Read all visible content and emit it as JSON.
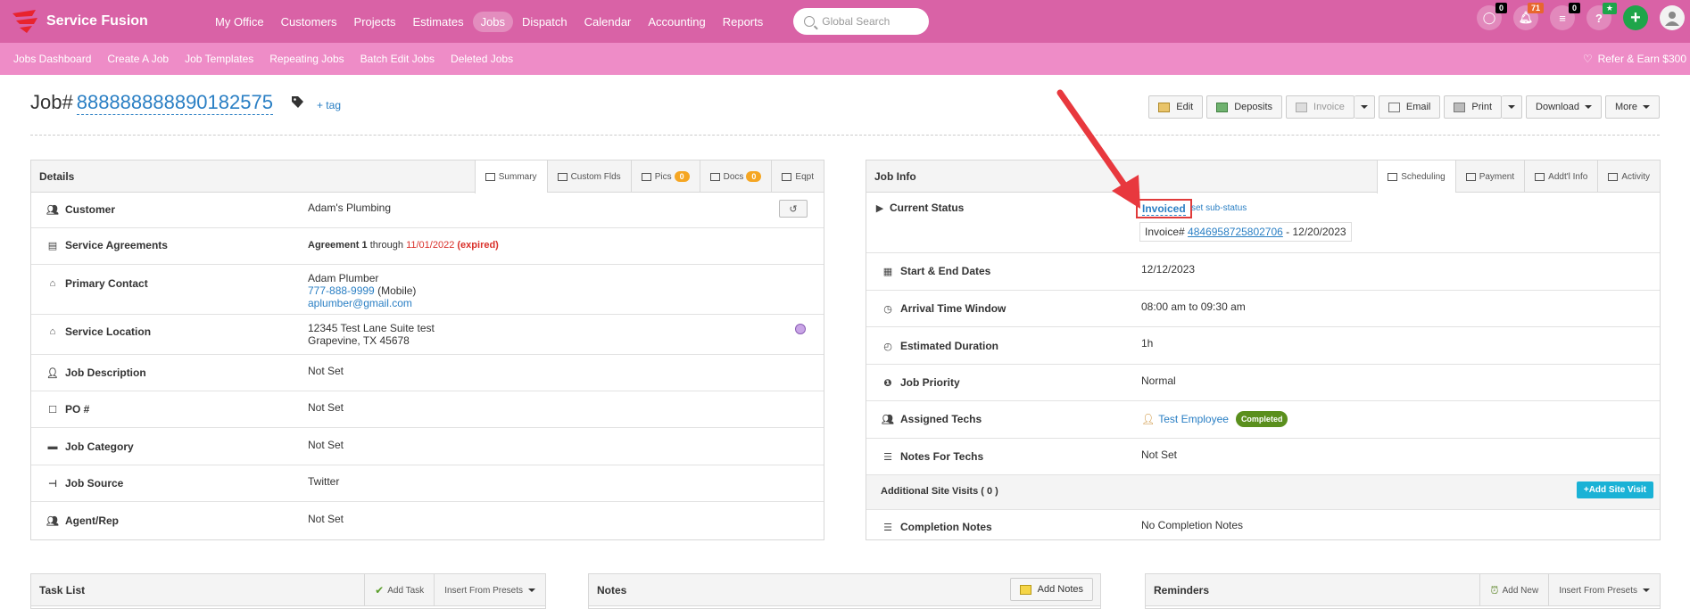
{
  "app": {
    "name": "Service Fusion"
  },
  "topnav": {
    "items": [
      {
        "label": "My Office",
        "active": false
      },
      {
        "label": "Customers",
        "active": false
      },
      {
        "label": "Projects",
        "active": false
      },
      {
        "label": "Estimates",
        "active": false
      },
      {
        "label": "Jobs",
        "active": true
      },
      {
        "label": "Dispatch",
        "active": false
      },
      {
        "label": "Calendar",
        "active": false
      },
      {
        "label": "Accounting",
        "active": false
      },
      {
        "label": "Reports",
        "active": false
      }
    ],
    "search_placeholder": "Global Search",
    "chat_count": "0",
    "notif_count": "71",
    "tasks_count": "0",
    "help": "?",
    "plus": "+",
    "brand_color": "#d962a6"
  },
  "subnav": {
    "items": [
      "Jobs Dashboard",
      "Create A Job",
      "Job Templates",
      "Repeating Jobs",
      "Batch Edit Jobs",
      "Deleted Jobs"
    ],
    "refer": "Refer & Earn $300"
  },
  "job": {
    "label": "Job#",
    "number": "888888888890182575",
    "add_tag": "+ tag"
  },
  "actions": {
    "edit": "Edit",
    "deposits": "Deposits",
    "invoice": "Invoice",
    "email": "Email",
    "print": "Print",
    "download": "Download",
    "more": "More"
  },
  "details": {
    "title": "Details",
    "tabs": [
      {
        "label": "Summary",
        "active": true
      },
      {
        "label": "Custom Flds"
      },
      {
        "label": "Pics",
        "count": "0"
      },
      {
        "label": "Docs",
        "count": "0"
      },
      {
        "label": "Eqpt"
      }
    ],
    "rows": {
      "customer": {
        "label": "Customer",
        "value": "Adam's Plumbing"
      },
      "agreements": {
        "label": "Service Agreements",
        "name": "Agreement 1",
        "through": "through",
        "date": "11/01/2022",
        "expired": "(expired)"
      },
      "contact": {
        "label": "Primary Contact",
        "name": "Adam Plumber",
        "phone": "777-888-9999",
        "phone_type": "(Mobile)",
        "email": "aplumber@gmail.com"
      },
      "location": {
        "label": "Service Location",
        "line1": "12345 Test Lane Suite test",
        "line2": "Grapevine, TX 45678"
      },
      "description": {
        "label": "Job Description",
        "value": "Not Set"
      },
      "po": {
        "label": "PO #",
        "value": "Not Set"
      },
      "category": {
        "label": "Job Category",
        "value": "Not Set"
      },
      "source": {
        "label": "Job Source",
        "value": "Twitter"
      },
      "agent": {
        "label": "Agent/Rep",
        "value": "Not Set"
      }
    }
  },
  "jobinfo": {
    "title": "Job Info",
    "tabs": [
      {
        "label": "Scheduling",
        "active": true
      },
      {
        "label": "Payment"
      },
      {
        "label": "Addt'l Info"
      },
      {
        "label": "Activity"
      }
    ],
    "rows": {
      "status": {
        "label": "Current Status",
        "value": "Invoiced",
        "sub_status": "set sub-status",
        "invoice_label": "Invoice#",
        "invoice_number": "4846958725802706",
        "invoice_date": "- 12/20/2023"
      },
      "dates": {
        "label": "Start & End Dates",
        "value": "12/12/2023"
      },
      "arrival": {
        "label": "Arrival Time Window",
        "value": "08:00 am to 09:30 am"
      },
      "duration": {
        "label": "Estimated Duration",
        "value": "1h"
      },
      "priority": {
        "label": "Job Priority",
        "value": "Normal"
      },
      "techs": {
        "label": "Assigned Techs",
        "name": "Test Employee",
        "badge": "Completed"
      },
      "notes": {
        "label": "Notes For Techs",
        "value": "Not Set"
      },
      "visits": {
        "label": "Additional Site Visits ( 0 )",
        "button": "+Add Site Visit"
      },
      "completion": {
        "label": "Completion Notes",
        "value": "No Completion Notes"
      }
    }
  },
  "bottom": {
    "tasks": {
      "title": "Task List",
      "add": "Add Task",
      "presets": "Insert From Presets"
    },
    "notes": {
      "title": "Notes",
      "add": "Add Notes"
    },
    "reminders": {
      "title": "Reminders",
      "add": "Add New",
      "presets": "Insert From Presets"
    }
  }
}
